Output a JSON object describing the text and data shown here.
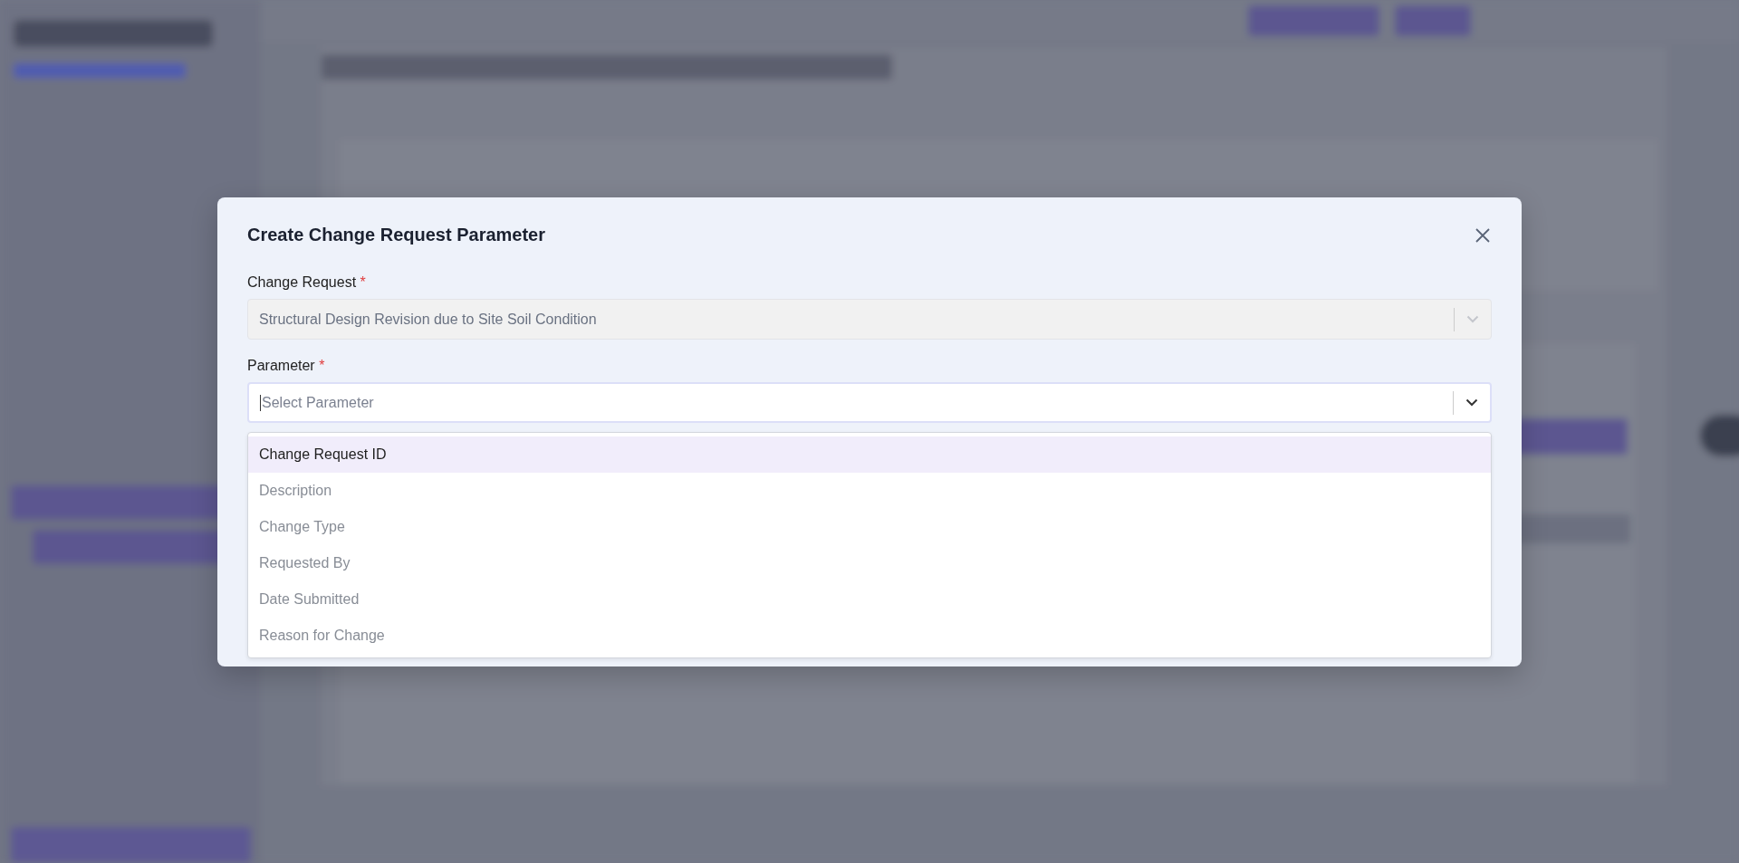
{
  "modal": {
    "title": "Create Change Request Parameter",
    "fields": [
      {
        "label": "Change Request",
        "required_mark": "*",
        "value": "Structural Design Revision due to Site Soil Condition",
        "disabled": true
      },
      {
        "label": "Parameter",
        "required_mark": "*",
        "placeholder": "Select Parameter",
        "disabled": false
      }
    ],
    "options": [
      {
        "label": "Change Request ID",
        "selected": true
      },
      {
        "label": "Description",
        "selected": false
      },
      {
        "label": "Change Type",
        "selected": false
      },
      {
        "label": "Requested By",
        "selected": false
      },
      {
        "label": "Date Submitted",
        "selected": false
      },
      {
        "label": "Reason for Change",
        "selected": false
      }
    ]
  }
}
